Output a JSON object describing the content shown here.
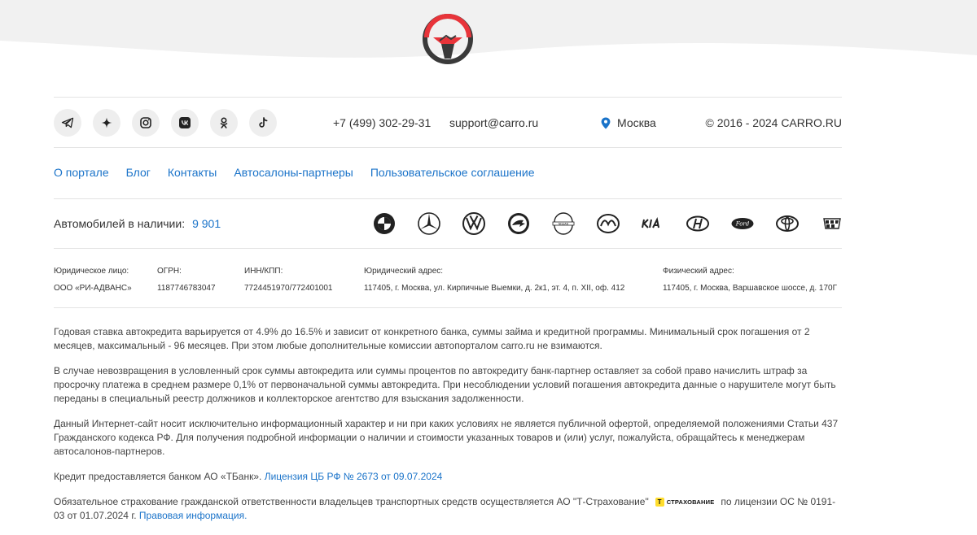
{
  "header": {
    "logo_icon": "steering-wheel-handshake-logo"
  },
  "social": [
    {
      "name": "telegram-icon"
    },
    {
      "name": "sparkle-icon"
    },
    {
      "name": "instagram-icon"
    },
    {
      "name": "vk-icon"
    },
    {
      "name": "odnoklassniki-icon"
    },
    {
      "name": "tiktok-icon"
    }
  ],
  "contacts": {
    "phone": "+7 (499) 302-29-31",
    "email": "support@carro.ru",
    "city": "Москва",
    "copyright": "© 2016 - 2024 CARRO.RU"
  },
  "nav": {
    "about": "О портале",
    "blog": "Блог",
    "contacts": "Контакты",
    "dealers": "Автосалоны-партнеры",
    "agreement": "Пользовательское соглашение"
  },
  "availability": {
    "label": "Автомобилей в наличии:",
    "count": "9 901"
  },
  "brands": [
    "bmw-icon",
    "mercedes-icon",
    "volkswagen-icon",
    "skoda-icon",
    "nissan-icon",
    "mazda-icon",
    "kia-icon",
    "hyundai-icon",
    "ford-icon",
    "toyota-icon",
    "cadillac-icon"
  ],
  "legal": {
    "entity_label": "Юридическое лицо:",
    "entity_value": "ООО «РИ-АДВАНС»",
    "ogrn_label": "ОГРН:",
    "ogrn_value": "1187746783047",
    "inn_label": "ИНН/КПП:",
    "inn_value": "7724451970/772401001",
    "legal_addr_label": "Юридический адрес:",
    "legal_addr_value": "117405, г. Москва, ул. Кирпичные Выемки, д. 2к1, эт. 4, п. XII, оф. 412",
    "phys_addr_label": "Физический адрес:",
    "phys_addr_value": "117405, г. Москва, Варшавское шоссе, д. 170Г"
  },
  "text": {
    "p1": "Годовая ставка автокредита варьируется от 4.9% до 16.5% и зависит от конкретного банка, суммы займа и кредитной программы. Минимальный срок погашения от 2 месяцев, максимальный - 96 месяцев. При этом любые дополнительные комиссии автопорталом carro.ru не взимаются.",
    "p2": "В случае невозвращения в условленный срок суммы автокредита или суммы процентов по автокредиту банк-партнер оставляет за собой право начислить штраф за просрочку платежа в среднем размере 0,1% от первоначальной суммы автокредита. При несоблюдении условий погашения автокредита данные о нарушителе могут быть переданы в специальный реестр должников и коллекторское агентство для взыскания задолженности.",
    "p3": "Данный Интернет-сайт носит исключительно информационный характер и ни при каких условиях не является публичной офертой, определяемой положениями Статьи 437 Гражданского кодекса РФ. Для получения подробной информации о наличии и стоимости указанных товаров и (или) услуг, пожалуйста, обращайтесь к менеджерам автосалонов-партнеров.",
    "p4_text": "Кредит предоставляется банком АО «ТБанк».",
    "p4_link": "Лицензия ЦБ РФ № 2673 от 09.07.2024",
    "p5_text": "Обязательное страхование гражданской ответственности владельцев транспортных средств осуществляется АО \"Т-Страхование\"",
    "p5_logo_letter": "Т",
    "p5_logo_text": "СТРАХОВАНИЕ",
    "p5_text2": "по лицензии ОС № 0191-03 от 01.07.2024 г.",
    "p5_link": "Правовая информация."
  },
  "colors": {
    "link": "#1a73c9",
    "logo_red": "#e8343a",
    "logo_dark": "#3a3a3a",
    "pin": "#1a73c9",
    "ins_yellow": "#ffdd2d"
  }
}
